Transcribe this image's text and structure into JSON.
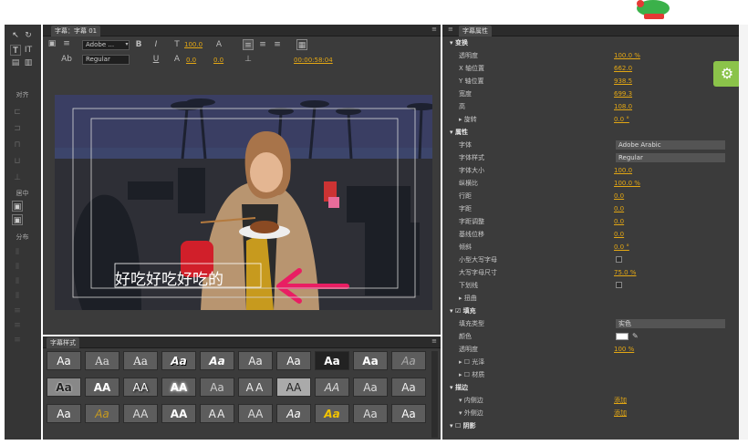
{
  "titles": {
    "title_panel_tab_active": "字幕：字幕 01",
    "title_panel_tab_menu": "▾",
    "properties_tab": "字幕属性",
    "styles_tab": "字幕样式"
  },
  "toolbar": {
    "font_family": "Adobe ...",
    "font_style": "Regular",
    "font_size": "100.0",
    "kerning": "0.0",
    "leading": "0.0",
    "timecode": "00:00:58:04"
  },
  "left_tools": {
    "align_label": "对齐",
    "center_label": "居中",
    "distribute_label": "分布"
  },
  "video": {
    "subtitle_text": "好吃好吃好吃的"
  },
  "properties": {
    "rows": [
      {
        "label": "▾ 变换",
        "value": "",
        "kind": "section"
      },
      {
        "label": "透明度",
        "value": "100.0 %",
        "kind": "value"
      },
      {
        "label": "X 轴位置",
        "value": "662.0",
        "kind": "value"
      },
      {
        "label": "Y 轴位置",
        "value": "938.5",
        "kind": "value"
      },
      {
        "label": "宽度",
        "value": "699.3",
        "kind": "value"
      },
      {
        "label": "高",
        "value": "108.0",
        "kind": "value"
      },
      {
        "label": "  ▸ 旋转",
        "value": "0.0 °",
        "kind": "value"
      },
      {
        "label": "▾ 属性",
        "value": "",
        "kind": "section"
      },
      {
        "label": "字体",
        "value": "Adobe Arabic",
        "kind": "dropdown"
      },
      {
        "label": "字体样式",
        "value": "Regular",
        "kind": "dropdown"
      },
      {
        "label": "字体大小",
        "value": "100.0",
        "kind": "value"
      },
      {
        "label": "纵横比",
        "value": "100.0 %",
        "kind": "value"
      },
      {
        "label": "行距",
        "value": "0.0",
        "kind": "value"
      },
      {
        "label": "字距",
        "value": "0.0",
        "kind": "value"
      },
      {
        "label": "字距调整",
        "value": "0.0",
        "kind": "value"
      },
      {
        "label": "基线位移",
        "value": "0.0",
        "kind": "value"
      },
      {
        "label": "倾斜",
        "value": "0.0 °",
        "kind": "value"
      },
      {
        "label": "小型大写字母",
        "value": "",
        "kind": "check"
      },
      {
        "label": "大写字母尺寸",
        "value": "75.0 %",
        "kind": "value"
      },
      {
        "label": "下划线",
        "value": "",
        "kind": "check"
      },
      {
        "label": "  ▸ 扭曲",
        "value": "",
        "kind": "value"
      },
      {
        "label": "▾ ☑ 填充",
        "value": "",
        "kind": "section"
      },
      {
        "label": "填充类型",
        "value": "实色",
        "kind": "dropdown"
      },
      {
        "label": "颜色",
        "value": "",
        "kind": "color"
      },
      {
        "label": "透明度",
        "value": "100 %",
        "kind": "value"
      },
      {
        "label": "  ▸ ☐ 光泽",
        "value": "",
        "kind": "value"
      },
      {
        "label": "  ▸ ☐ 材质",
        "value": "",
        "kind": "value"
      },
      {
        "label": "▾ 描边",
        "value": "",
        "kind": "section"
      },
      {
        "label": "  ▾ 内侧边",
        "value": "添加",
        "kind": "value"
      },
      {
        "label": "  ▾ 外侧边",
        "value": "添加",
        "kind": "value"
      },
      {
        "label": "▾ ☐ 阴影",
        "value": "",
        "kind": "section"
      }
    ]
  },
  "styles": {
    "swatches": [
      "Aa",
      "Aa",
      "Aa",
      "Aa",
      "Aa",
      "Aa",
      "Aa",
      "Aa",
      "Aa",
      "Aa",
      "Aa",
      "AA",
      "AA",
      "AA",
      "Aa",
      "AA",
      "AA",
      "AA",
      "Aa",
      "Aa",
      "Aa",
      "Aa",
      "AA",
      "AA",
      "AA",
      "AA",
      "Aa",
      "Aa",
      "Aa",
      "Aa"
    ]
  }
}
